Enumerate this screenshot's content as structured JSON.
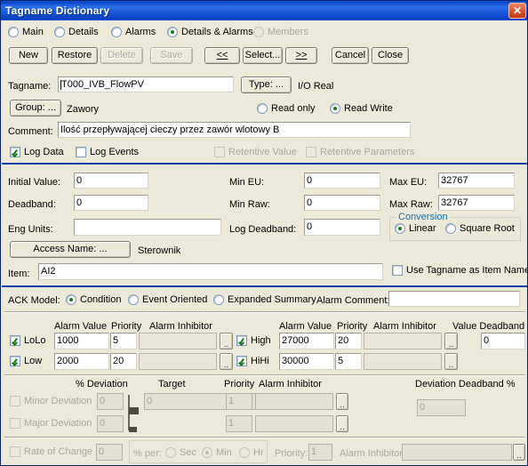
{
  "window": {
    "title": "Tagname Dictionary",
    "close_icon": "close-icon",
    "close_label": "✕"
  },
  "view_modes": {
    "label_main": "Main",
    "label_details": "Details",
    "label_alarms": "Alarms",
    "label_details_alarms": "Details & Alarms",
    "label_members": "Members",
    "selected": "Details & Alarms"
  },
  "toolbar": {
    "new": "New",
    "restore": "Restore",
    "delete": "Delete",
    "save": "Save",
    "prev": "<<",
    "select": "Select...",
    "next": ">>",
    "cancel": "Cancel",
    "close": "Close"
  },
  "main": {
    "tagname_label": "Tagname:",
    "tagname_value": "T000_IVB_FlowPV",
    "type_button": "Type: ...",
    "type_value": "I/O Real",
    "group_button": "Group: ...",
    "group_value": "Zawory",
    "read_only_label": "Read only",
    "read_write_label": "Read Write",
    "access_mode": "Read Write",
    "comment_label": "Comment:",
    "comment_value": "Ilość przepływającej cieczy przez zawór wlotowy B",
    "log_data_label": "Log Data",
    "log_data_checked": true,
    "log_events_label": "Log Events",
    "log_events_checked": false,
    "retentive_value_label": "Retentive Value",
    "retentive_params_label": "Retentive Parameters"
  },
  "details": {
    "initial_value_label": "Initial Value:",
    "initial_value": "0",
    "deadband_label": "Deadband:",
    "deadband_value": "0",
    "eng_units_label": "Eng Units:",
    "eng_units_value": "",
    "min_eu_label": "Min EU:",
    "min_eu_value": "0",
    "min_raw_label": "Min Raw:",
    "min_raw_value": "0",
    "log_deadband_label": "Log Deadband:",
    "log_deadband_value": "0",
    "max_eu_label": "Max EU:",
    "max_eu_value": "32767",
    "max_raw_label": "Max Raw:",
    "max_raw_value": "32767",
    "conversion_group": "Conversion",
    "conversion_linear": "Linear",
    "conversion_sqrt": "Square Root",
    "conversion_selected": "Linear",
    "access_name_button": "Access Name: ...",
    "access_name_value": "Sterownik",
    "item_label": "Item:",
    "item_value": "AI2",
    "use_tagname_label": "Use Tagname as Item Name",
    "use_tagname_checked": false
  },
  "alarms": {
    "ack_model_label": "ACK Model:",
    "ack_condition": "Condition",
    "ack_event_oriented": "Event Oriented",
    "ack_expanded_summary": "Expanded Summary",
    "ack_selected": "Condition",
    "alarm_comment_label": "Alarm Comment:",
    "alarm_comment_value": "",
    "col_alarm_value": "Alarm Value",
    "col_priority": "Priority",
    "col_alarm_inhibitor": "Alarm Inhibitor",
    "col_value_deadband": "Value Deadband",
    "value_deadband_value": "0",
    "left_rows": [
      {
        "name": "LoLo",
        "checked": true,
        "value": "1000",
        "priority": "5",
        "inhibitor": ""
      },
      {
        "name": "Low",
        "checked": true,
        "value": "2000",
        "priority": "20",
        "inhibitor": ""
      }
    ],
    "right_rows": [
      {
        "name": "High",
        "checked": true,
        "value": "27000",
        "priority": "20",
        "inhibitor": ""
      },
      {
        "name": "HiHi",
        "checked": true,
        "value": "30000",
        "priority": "5",
        "inhibitor": ""
      }
    ],
    "browse_label": ".."
  },
  "deviation": {
    "col_pct_deviation": "% Deviation",
    "col_target": "Target",
    "col_priority": "Priority",
    "col_alarm_inhibitor": "Alarm Inhibitor",
    "col_deviation_deadband": "Deviation Deadband %",
    "target_value": "0",
    "deadband_value": "0",
    "rows": [
      {
        "name": "Minor Deviation",
        "checked": false,
        "pct": "0",
        "priority": "1",
        "inhibitor": ""
      },
      {
        "name": "Major Deviation",
        "checked": false,
        "pct": "0",
        "priority": "1",
        "inhibitor": ""
      }
    ]
  },
  "rate_of_change": {
    "label": "Rate of Change",
    "checked": false,
    "value": "0",
    "pct_per_label": "% per:",
    "unit_sec": "Sec",
    "unit_min": "Min",
    "unit_hr": "Hr",
    "unit_selected": "Min",
    "priority_label": "Priority:",
    "priority_value": "1",
    "alarm_inhibitor_label": "Alarm Inhibitor",
    "alarm_inhibitor_value": ""
  }
}
